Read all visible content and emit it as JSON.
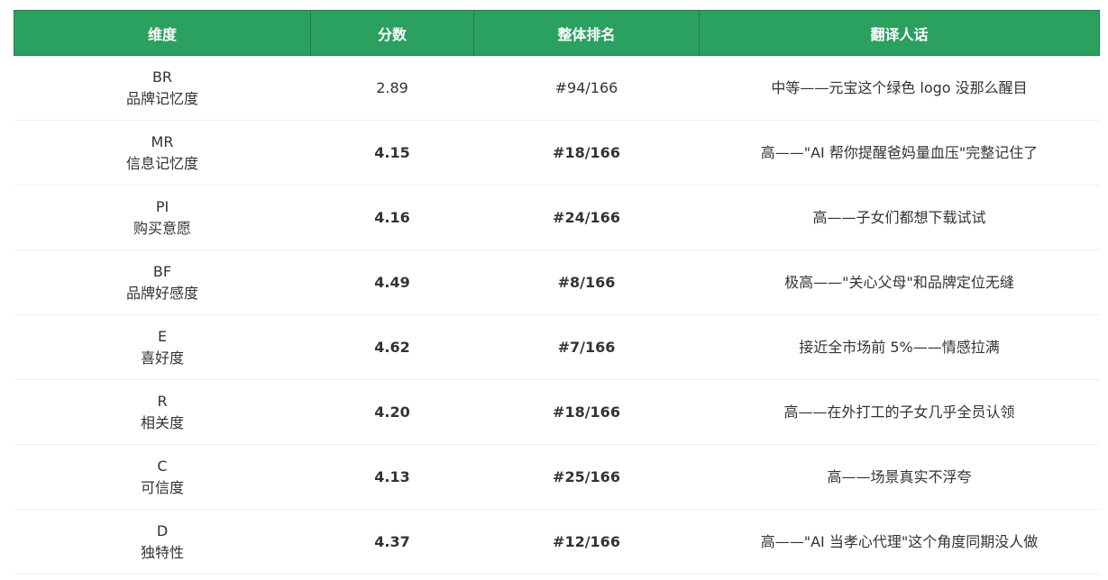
{
  "headers": [
    "维度",
    "分数",
    "整体排名",
    "翻译人话"
  ],
  "rows": [
    {
      "code": "BR",
      "name": "品牌记忆度",
      "score": "2.89",
      "rank": "#94/166",
      "note": "中等——元宝这个绿色 logo 没那么醒目",
      "bold": false
    },
    {
      "code": "MR",
      "name": "信息记忆度",
      "score": "4.15",
      "rank": "#18/166",
      "note": "高——\"AI 帮你提醒爸妈量血压\"完整记住了",
      "bold": true
    },
    {
      "code": "PI",
      "name": "购买意愿",
      "score": "4.16",
      "rank": "#24/166",
      "note": "高——子女们都想下载试试",
      "bold": true
    },
    {
      "code": "BF",
      "name": "品牌好感度",
      "score": "4.49",
      "rank": "#8/166",
      "note": "极高——\"关心父母\"和品牌定位无缝",
      "bold": true
    },
    {
      "code": "E",
      "name": "喜好度",
      "score": "4.62",
      "rank": "#7/166",
      "note": "接近全市场前 5%——情感拉满",
      "bold": true
    },
    {
      "code": "R",
      "name": "相关度",
      "score": "4.20",
      "rank": "#18/166",
      "note": "高——在外打工的子女几乎全员认领",
      "bold": true
    },
    {
      "code": "C",
      "name": "可信度",
      "score": "4.13",
      "rank": "#25/166",
      "note": "高——场景真实不浮夸",
      "bold": true
    },
    {
      "code": "D",
      "name": "独特性",
      "score": "4.37",
      "rank": "#12/166",
      "note": "高——\"AI 当孝心代理\"这个角度同期没人做",
      "bold": true
    }
  ],
  "colors": {
    "header_bg": "#2ba15f",
    "header_text": "#ffffff",
    "body_text": "#333333",
    "row_divider": "#eeeeee"
  }
}
